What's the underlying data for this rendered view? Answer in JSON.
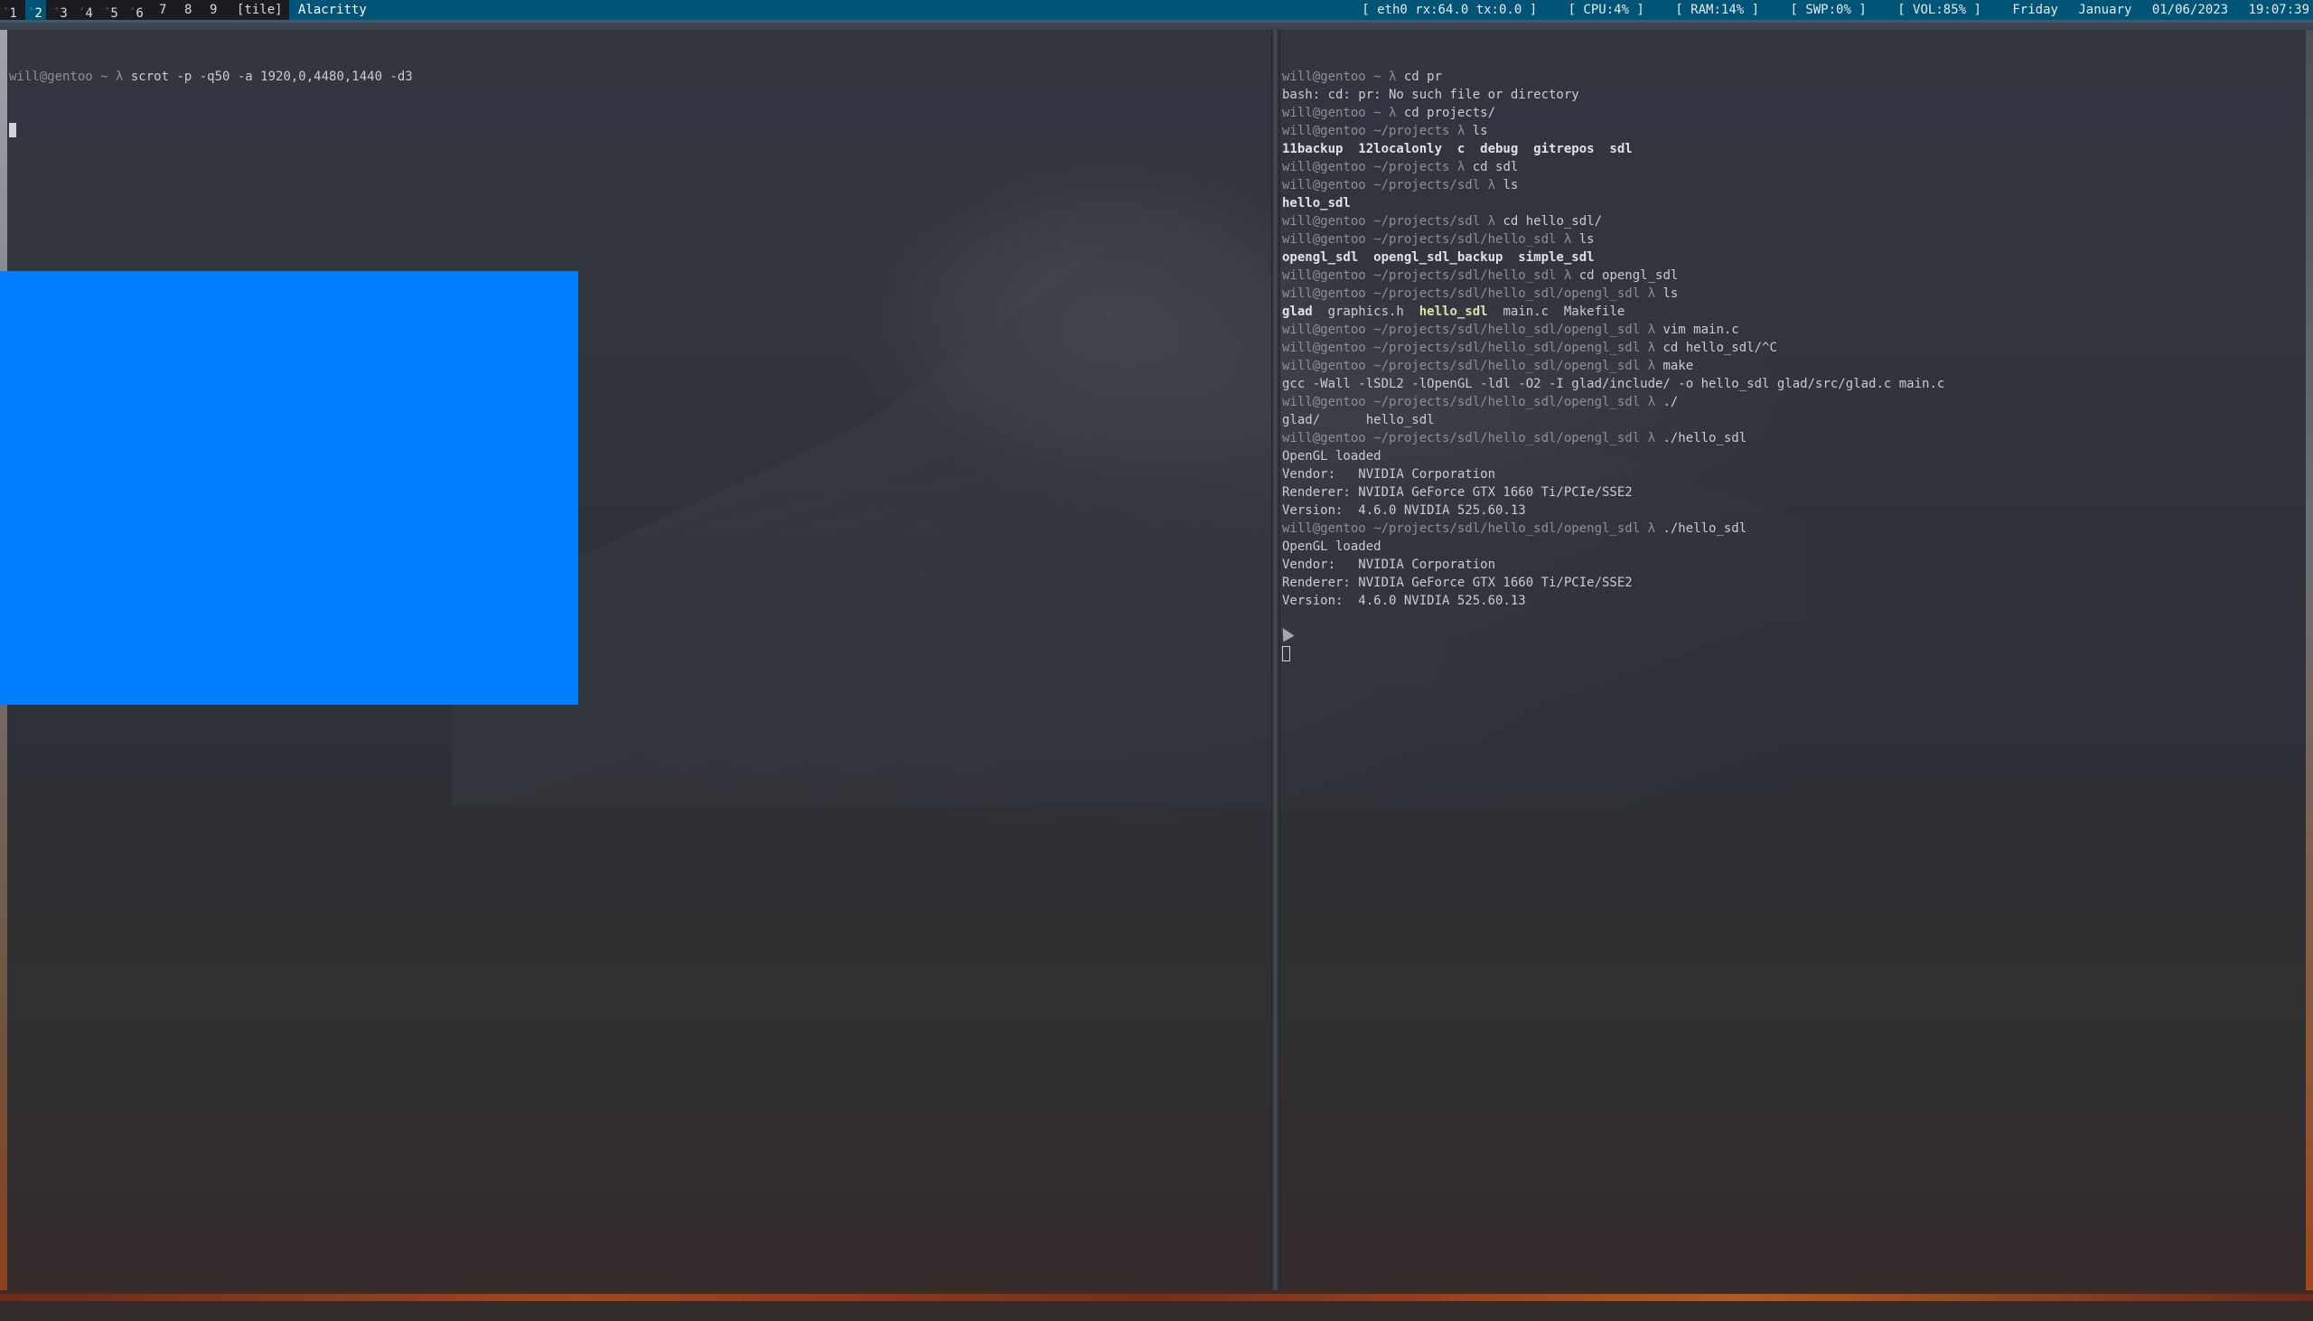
{
  "topbar": {
    "workspaces": [
      {
        "sup": "◦",
        "label": "1",
        "active": false
      },
      {
        "sup": "◦",
        "label": "2",
        "active": true
      },
      {
        "sup": "◦",
        "label": "3",
        "active": false
      },
      {
        "sup": "◦",
        "label": "4",
        "active": false
      },
      {
        "sup": "◦",
        "label": "5",
        "active": false
      },
      {
        "sup": "◦",
        "label": "6",
        "active": false
      },
      {
        "sup": "",
        "label": "7",
        "active": false
      },
      {
        "sup": "",
        "label": "8",
        "active": false
      },
      {
        "sup": "",
        "label": "9",
        "active": false
      }
    ],
    "layout": "[tile]",
    "window_title": "Alacritty",
    "status": {
      "net": "[ eth0 rx:64.0  tx:0.0 ]",
      "cpu": "[ CPU:4% ]",
      "ram": "[ RAM:14% ]",
      "swp": "[ SWP:0% ]",
      "vol": "[ VOL:85% ]",
      "day": "Friday",
      "month": "January",
      "date": "01/06/2023",
      "time": "19:07:39"
    }
  },
  "left_terminal": {
    "prompt": "will@gentoo ~ λ",
    "command": " scrot -p -q50 -a 1920,0,4480,1440 -d3"
  },
  "right_terminal": {
    "lines": [
      {
        "type": "prompt",
        "prompt": "will@gentoo ~ λ",
        "text": " cd pr"
      },
      {
        "type": "out",
        "text": "bash: cd: pr: No such file or directory"
      },
      {
        "type": "prompt",
        "prompt": "will@gentoo ~ λ",
        "text": " cd projects/"
      },
      {
        "type": "prompt",
        "prompt": "will@gentoo ~/projects λ",
        "text": " ls"
      },
      {
        "type": "dirs",
        "text": "11backup  12localonly  c  debug  gitrepos  sdl"
      },
      {
        "type": "prompt",
        "prompt": "will@gentoo ~/projects λ",
        "text": " cd sdl"
      },
      {
        "type": "prompt",
        "prompt": "will@gentoo ~/projects/sdl λ",
        "text": " ls"
      },
      {
        "type": "dirs",
        "text": "hello_sdl"
      },
      {
        "type": "prompt",
        "prompt": "will@gentoo ~/projects/sdl λ",
        "text": " cd hello_sdl/"
      },
      {
        "type": "prompt",
        "prompt": "will@gentoo ~/projects/sdl/hello_sdl λ",
        "text": " ls"
      },
      {
        "type": "dirs",
        "text": "opengl_sdl  opengl_sdl_backup  simple_sdl"
      },
      {
        "type": "prompt",
        "prompt": "will@gentoo ~/projects/sdl/hello_sdl λ",
        "text": " cd opengl_sdl"
      },
      {
        "type": "prompt",
        "prompt": "will@gentoo ~/projects/sdl/hello_sdl/opengl_sdl λ",
        "text": " ls"
      },
      {
        "type": "ls_mixed",
        "a": "glad",
        "b": "  graphics.h  ",
        "c": "hello_sdl",
        "d": "  main.c  Makefile"
      },
      {
        "type": "prompt",
        "prompt": "will@gentoo ~/projects/sdl/hello_sdl/opengl_sdl λ",
        "text": " vim main.c"
      },
      {
        "type": "prompt",
        "prompt": "will@gentoo ~/projects/sdl/hello_sdl/opengl_sdl λ",
        "text": " cd hello_sdl/^C"
      },
      {
        "type": "prompt",
        "prompt": "will@gentoo ~/projects/sdl/hello_sdl/opengl_sdl λ",
        "text": " make"
      },
      {
        "type": "out",
        "text": "gcc -Wall -lSDL2 -lOpenGL -ldl -O2 -I glad/include/ -o hello_sdl glad/src/glad.c main.c"
      },
      {
        "type": "prompt",
        "prompt": "will@gentoo ~/projects/sdl/hello_sdl/opengl_sdl λ",
        "text": " ./"
      },
      {
        "type": "out",
        "text": "glad/      hello_sdl"
      },
      {
        "type": "prompt",
        "prompt": "will@gentoo ~/projects/sdl/hello_sdl/opengl_sdl λ",
        "text": " ./hello_sdl"
      },
      {
        "type": "out",
        "text": "OpenGL loaded"
      },
      {
        "type": "out",
        "text": "Vendor:   NVIDIA Corporation"
      },
      {
        "type": "out",
        "text": "Renderer: NVIDIA GeForce GTX 1660 Ti/PCIe/SSE2"
      },
      {
        "type": "out",
        "text": "Version:  4.6.0 NVIDIA 525.60.13"
      },
      {
        "type": "prompt",
        "prompt": "will@gentoo ~/projects/sdl/hello_sdl/opengl_sdl λ",
        "text": " ./hello_sdl"
      },
      {
        "type": "out",
        "text": "OpenGL loaded"
      },
      {
        "type": "out",
        "text": "Vendor:   NVIDIA Corporation"
      },
      {
        "type": "out",
        "text": "Renderer: NVIDIA GeForce GTX 1660 Ti/PCIe/SSE2"
      },
      {
        "type": "out",
        "text": "Version:  4.6.0 NVIDIA 525.60.13"
      }
    ]
  },
  "sdl_window": {
    "color": "#0080ff"
  }
}
